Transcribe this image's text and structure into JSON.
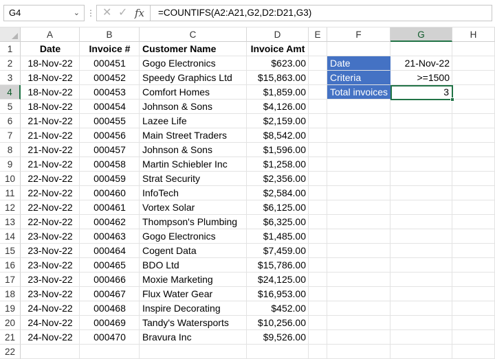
{
  "namebox": {
    "value": "G4"
  },
  "formula_bar": {
    "formula": "=COUNTIFS(A2:A21,G2,D2:D21,G3)"
  },
  "icons": {
    "cancel": "✕",
    "enter": "✓",
    "fx": "fx",
    "chevron": "⌄",
    "dots": "⋮"
  },
  "columns": [
    "A",
    "B",
    "C",
    "D",
    "E",
    "F",
    "G",
    "H"
  ],
  "rows": [
    "1",
    "2",
    "3",
    "4",
    "5",
    "6",
    "7",
    "8",
    "9",
    "10",
    "11",
    "12",
    "13",
    "14",
    "15",
    "16",
    "17",
    "18",
    "19",
    "20",
    "21",
    "22"
  ],
  "headers": {
    "date": "Date",
    "invoice": "Invoice #",
    "customer": "Customer Name",
    "amount": "Invoice Amt"
  },
  "table": [
    [
      "18-Nov-22",
      "000451",
      "Gogo Electronics",
      "$623.00"
    ],
    [
      "18-Nov-22",
      "000452",
      "Speedy Graphics Ltd",
      "$15,863.00"
    ],
    [
      "18-Nov-22",
      "000453",
      "Comfort Homes",
      "$1,859.00"
    ],
    [
      "18-Nov-22",
      "000454",
      "Johnson & Sons",
      "$4,126.00"
    ],
    [
      "21-Nov-22",
      "000455",
      "Lazee Life",
      "$2,159.00"
    ],
    [
      "21-Nov-22",
      "000456",
      "Main Street Traders",
      "$8,542.00"
    ],
    [
      "21-Nov-22",
      "000457",
      "Johnson & Sons",
      "$1,596.00"
    ],
    [
      "21-Nov-22",
      "000458",
      "Martin Schiebler Inc",
      "$1,258.00"
    ],
    [
      "22-Nov-22",
      "000459",
      "Strat Security",
      "$2,356.00"
    ],
    [
      "22-Nov-22",
      "000460",
      "InfoTech",
      "$2,584.00"
    ],
    [
      "22-Nov-22",
      "000461",
      "Vortex Solar",
      "$6,125.00"
    ],
    [
      "22-Nov-22",
      "000462",
      "Thompson's Plumbing",
      "$6,325.00"
    ],
    [
      "23-Nov-22",
      "000463",
      "Gogo Electronics",
      "$1,485.00"
    ],
    [
      "23-Nov-22",
      "000464",
      "Cogent Data",
      "$7,459.00"
    ],
    [
      "23-Nov-22",
      "000465",
      "BDO Ltd",
      "$15,786.00"
    ],
    [
      "23-Nov-22",
      "000466",
      "Moxie Marketing",
      "$24,125.00"
    ],
    [
      "23-Nov-22",
      "000467",
      "Flux Water Gear",
      "$16,953.00"
    ],
    [
      "24-Nov-22",
      "000468",
      "Inspire Decorating",
      "$452.00"
    ],
    [
      "24-Nov-22",
      "000469",
      "Tandy's Watersports",
      "$10,256.00"
    ],
    [
      "24-Nov-22",
      "000470",
      "Bravura Inc",
      "$9,526.00"
    ]
  ],
  "criteria": [
    {
      "label": "Date",
      "value": "21-Nov-22"
    },
    {
      "label": "Criteria",
      "value": ">=1500"
    },
    {
      "label": "Total invoices",
      "value": "3"
    }
  ],
  "active_cell": "G4",
  "colors": {
    "label_fill": "#4472c4",
    "selection": "#217346"
  }
}
